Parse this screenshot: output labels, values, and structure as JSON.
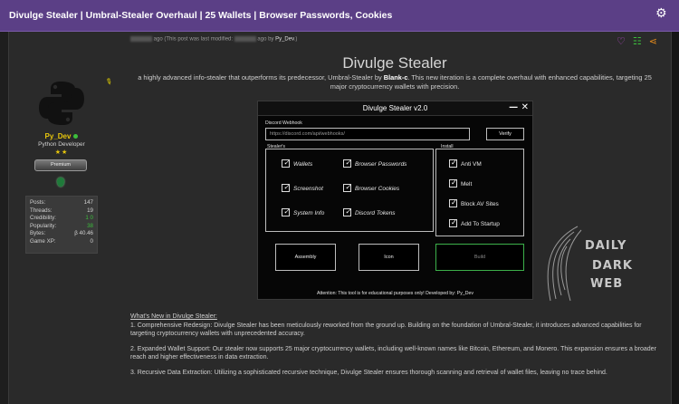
{
  "thread": {
    "title": "Divulge Stealer | Umbral-Stealer Overhaul | 25 Wallets | Browser Passwords, Cookies",
    "meta_prefix": "ago (This post was last modified:",
    "meta_suffix": "ago by",
    "meta_author": "Py_Dev",
    "meta_close": ".)"
  },
  "icons": {
    "settings": "gear-icon",
    "like": "heart-icon",
    "tree": "sitemap-icon",
    "share": "share-icon"
  },
  "colors": {
    "titlebar": "#5b3f86",
    "username": "#e7c60c",
    "online": "#3cbf3c",
    "build_border": "#3cb04a"
  },
  "user": {
    "name": "Py_Dev",
    "role": "Python Developer",
    "stars": "★★",
    "badge_text": "Premium",
    "stats": [
      {
        "label": "Posts:",
        "value": "147"
      },
      {
        "label": "Threads:",
        "value": "19"
      },
      {
        "label": "Credibility:",
        "value": "1 0"
      },
      {
        "label": "Popularity:",
        "value": "38"
      },
      {
        "label": "Bytes:",
        "value": "β 40.46"
      },
      {
        "label": "Game XP:",
        "value": "0"
      }
    ]
  },
  "article": {
    "headline": "Divulge Stealer",
    "lead_before": "a highly advanced info-stealer that outperforms its predecessor, Umbral-Stealer by ",
    "lead_author": "Blank-c",
    "lead_after": ". This new iteration is a complete overhaul with enhanced capabilities, targeting 25 major cryptocurrency wallets with precision.",
    "whats_new": "What's New in Divulge Stealer:",
    "points": [
      "1. Comprehensive Redesign: Divulge Stealer has been meticulously reworked from the ground up. Building on the foundation of Umbral-Stealer, it introduces advanced capabilities for targeting cryptocurrency wallets with unprecedented accuracy.",
      "2. Expanded Wallet Support: Our stealer now supports 25 major cryptocurrency wallets, including well-known names like Bitcoin, Ethereum, and Monero. This expansion ensures a broader reach and higher effectiveness in data extraction.",
      "3. Recursive Data Extraction: Utilizing a sophisticated recursive technique, Divulge Stealer ensures thorough scanning and retrieval of wallet files, leaving no trace behind."
    ]
  },
  "app": {
    "title": "Divulge Stealer v2.0",
    "controls": "— ✕",
    "webhook_label": "Discord Webhook",
    "webhook_placeholder": "https://discord.com/api/webhooks/",
    "verify": "Verify",
    "stealers_label": "Stealer's",
    "install_label": "Install",
    "stealers": [
      "Wallets",
      "Browser Passwords",
      "Screenshot",
      "Browser Cookies",
      "System Info",
      "Discord Tokens"
    ],
    "install": [
      "Anti VM",
      "Melt",
      "Block AV Sites",
      "Add To Startup"
    ],
    "buttons": {
      "assembly": "Assembly",
      "icon": "Icon",
      "build": "Build"
    },
    "attention": "Attention: This tool is for educational purposes only! Developed by: Py_Dev"
  },
  "watermark": {
    "line1": "DAILY",
    "line2": "DARK",
    "line3": "WEB"
  }
}
